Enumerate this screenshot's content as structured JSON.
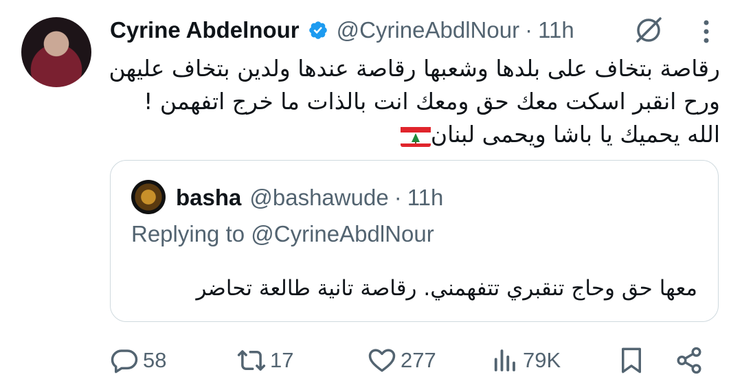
{
  "author": {
    "name": "Cyrine Abdelnour",
    "handle": "@CyrineAbdlNour",
    "separator": "·",
    "time": "11h"
  },
  "tweet": {
    "lines": [
      "رقاصة بتخاف على بلدها وشعبها رقاصة عندها ولدين بتخاف عليهن",
      "ورح انقبر اسكت معك حق ومعك انت بالذات ما خرج اتفهمن !",
      "الله يحميك يا باشا ويحمى لبنان"
    ],
    "flag_emoji": "🇱🇧"
  },
  "quote": {
    "name": "basha",
    "handle": "@bashawude",
    "separator": "·",
    "time": "11h",
    "replying_to": "Replying to @CyrineAbdlNour",
    "text": "معها حق وحاج تنقبري تتفهمني.  رقاصة تانية طالعة تحاضر"
  },
  "actions": {
    "replies": "58",
    "reposts": "17",
    "likes": "277",
    "views": "79K"
  },
  "colors": {
    "text": "#0f1419",
    "secondary": "#536471",
    "verified": "#1d9bf0",
    "border": "#cfd9de"
  }
}
